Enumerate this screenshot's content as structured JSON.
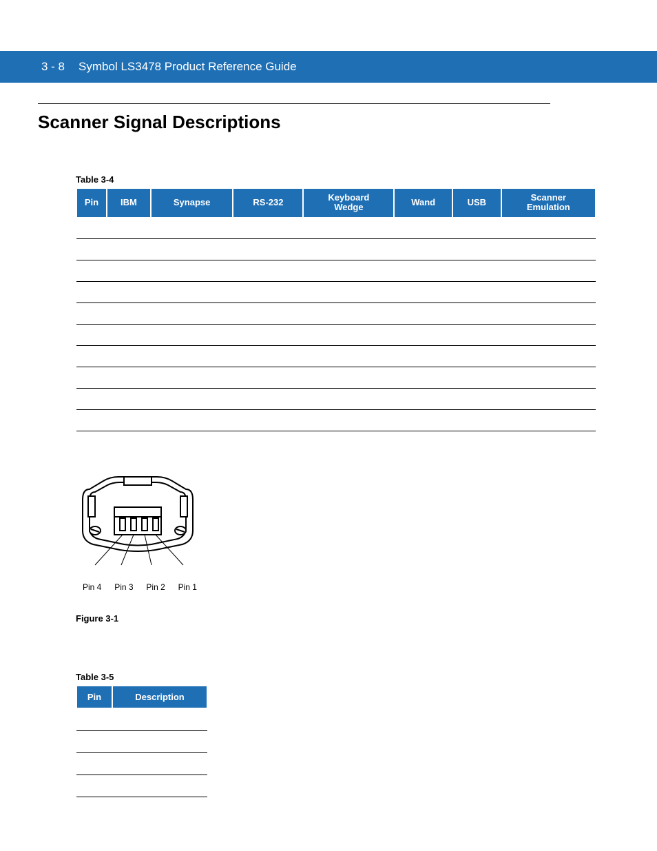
{
  "header": {
    "page_number": "3 - 8",
    "doc_title": "Symbol LS3478 Product Reference Guide"
  },
  "section": {
    "heading": "Scanner Signal Descriptions"
  },
  "table34": {
    "caption": "Table 3-4",
    "headers": [
      "Pin",
      "IBM",
      "Synapse",
      "RS-232",
      "Keyboard Wedge",
      "Wand",
      "USB",
      "Scanner Emulation"
    ],
    "row_count": 10
  },
  "figure": {
    "caption": "Figure 3-1",
    "pin_labels": [
      "Pin 4",
      "Pin 3",
      "Pin 2",
      "Pin 1"
    ]
  },
  "table35": {
    "caption": "Table 3-5",
    "headers": [
      "Pin",
      "Description"
    ],
    "row_count": 4
  }
}
